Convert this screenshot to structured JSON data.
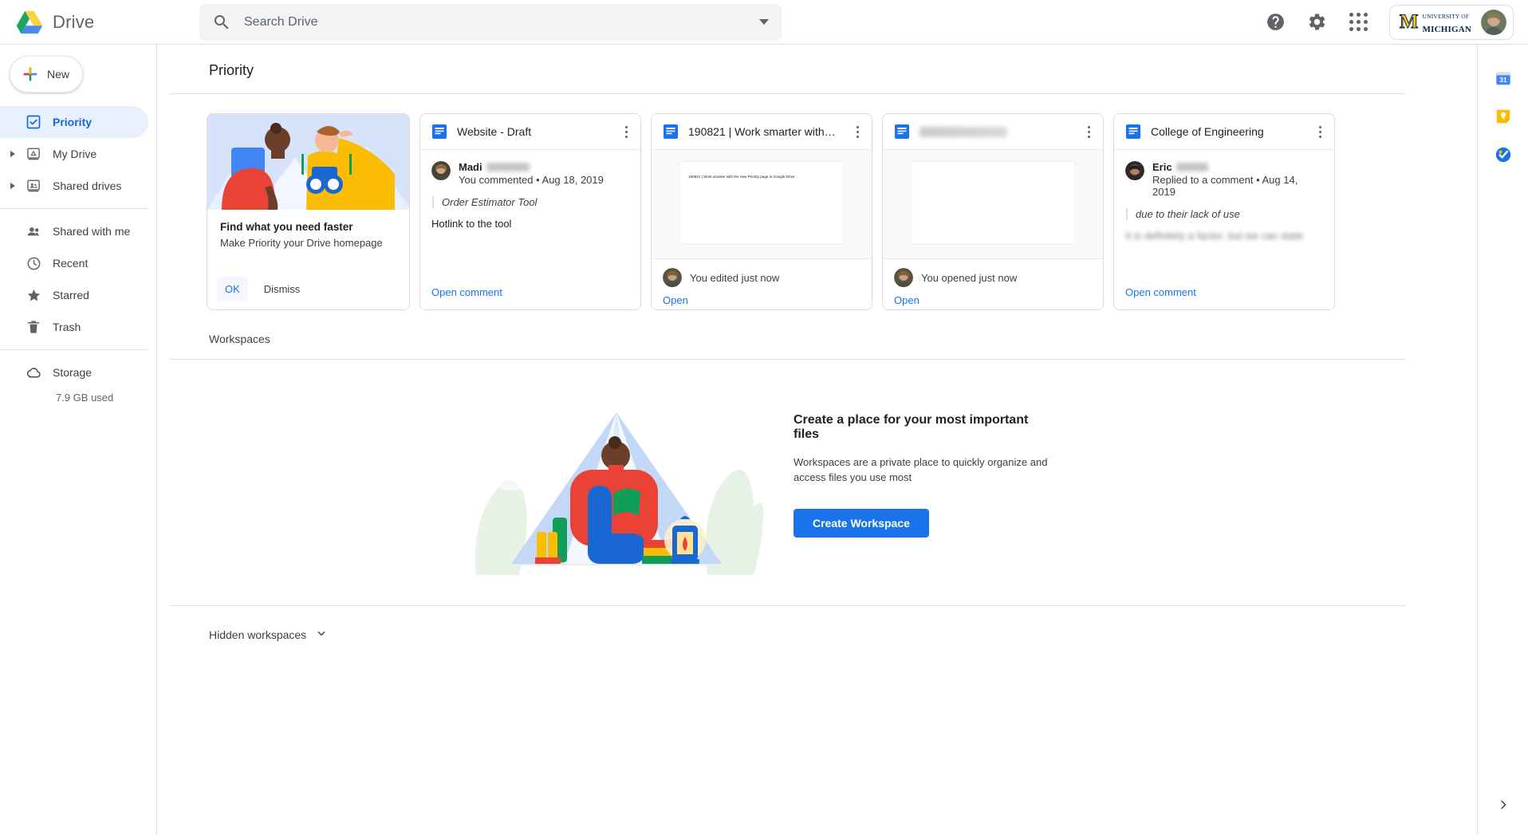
{
  "app": {
    "name": "Drive",
    "logo_icon": "drive-logo-icon"
  },
  "search": {
    "placeholder": "Search Drive",
    "value": "",
    "icon": "search-icon",
    "options_icon": "chevron-down-icon"
  },
  "header": {
    "help_icon": "help-icon",
    "settings_icon": "gear-icon",
    "apps_icon": "apps-grid-icon",
    "org_logo_line1": "UNIVERSITY OF",
    "org_logo_line2": "MICHIGAN",
    "org_logo_mark": "M",
    "avatar_icon": "avatar"
  },
  "sidebar": {
    "new_button": "New",
    "new_icon": "plus-icon",
    "items": [
      {
        "label": "Priority",
        "icon": "priority-check-icon",
        "active": true,
        "expandable": false
      },
      {
        "label": "My Drive",
        "icon": "my-drive-icon",
        "active": false,
        "expandable": true
      },
      {
        "label": "Shared drives",
        "icon": "shared-drives-icon",
        "active": false,
        "expandable": true
      },
      {
        "label": "Shared with me",
        "icon": "people-icon",
        "active": false,
        "expandable": false
      },
      {
        "label": "Recent",
        "icon": "clock-icon",
        "active": false,
        "expandable": false
      },
      {
        "label": "Starred",
        "icon": "star-icon",
        "active": false,
        "expandable": false
      },
      {
        "label": "Trash",
        "icon": "trash-icon",
        "active": false,
        "expandable": false
      }
    ],
    "storage": {
      "label": "Storage",
      "icon": "cloud-icon",
      "used": "7.9 GB used"
    }
  },
  "priority": {
    "title": "Priority",
    "promo_card": {
      "heading": "Find what you need faster",
      "subtext": "Make Priority your Drive homepage",
      "ok_label": "OK",
      "dismiss_label": "Dismiss",
      "illustration": "two-hikers-illustration"
    },
    "cards": [
      {
        "type": "comment",
        "title": "Website - Draft",
        "title_redacted": false,
        "file_icon": "google-docs-icon",
        "menu_icon": "kebab-menu-icon",
        "author": "Madi",
        "author_redacted": true,
        "meta": "You commented • Aug 18, 2019",
        "quote": "Order Estimator Tool",
        "body": "Hotlink to the tool",
        "body_blurred": false,
        "action": "Open comment"
      },
      {
        "type": "preview",
        "title": "190821 | Work smarter with the …",
        "title_redacted": false,
        "file_icon": "google-docs-icon",
        "menu_icon": "kebab-menu-icon",
        "preview_text": "190821 | Work smarter with the new Priority page in Google Drive",
        "status": "You edited just now",
        "action": "Open"
      },
      {
        "type": "preview",
        "title": "1",
        "title_redacted": true,
        "file_icon": "google-docs-icon",
        "menu_icon": "kebab-menu-icon",
        "preview_text": "",
        "status": "You opened just now",
        "action": "Open"
      },
      {
        "type": "comment",
        "title": "College of Engineering",
        "title_redacted": false,
        "file_icon": "google-docs-icon",
        "menu_icon": "kebab-menu-icon",
        "author": "Eric",
        "author_redacted": true,
        "meta": "Replied to a comment • Aug 14, 2019",
        "quote": "due to their lack of use",
        "body": "It is definitely a factor, but we can state",
        "body_blurred": true,
        "action": "Open comment"
      }
    ]
  },
  "workspaces": {
    "title": "Workspaces",
    "empty_heading": "Create a place for your most important files",
    "empty_text": "Workspaces are a private place to quickly organize and access files you use most",
    "create_button": "Create Workspace",
    "illustration": "camping-tent-illustration",
    "hidden_label": "Hidden workspaces",
    "hidden_chevron": "chevron-down-icon"
  },
  "rail": {
    "items": [
      {
        "name": "google-calendar-icon",
        "label": "31"
      },
      {
        "name": "google-keep-icon",
        "label": ""
      },
      {
        "name": "google-tasks-icon",
        "label": ""
      }
    ],
    "expand_icon": "chevron-right-icon"
  },
  "colors": {
    "accent": "#1a73e8",
    "active_bg": "#e8f0fe",
    "active_text": "#1967d2",
    "border": "#e0e0e0",
    "text_primary": "#202124",
    "text_secondary": "#5f6368",
    "michigan_maize": "#FFCB05",
    "michigan_blue": "#00274C"
  }
}
